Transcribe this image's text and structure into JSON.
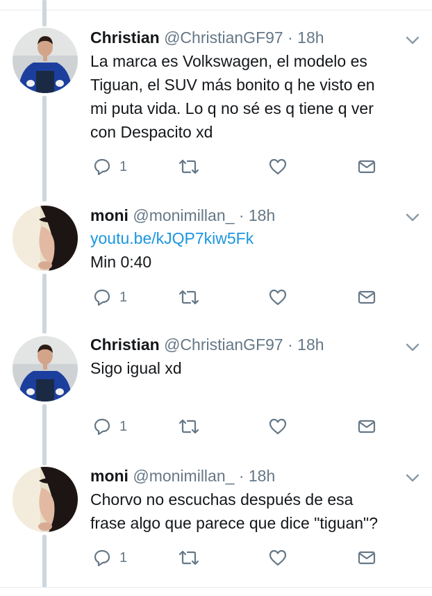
{
  "tweets": [
    {
      "name": "Christian",
      "handle": "@ChristianGF97",
      "separator": "·",
      "time": "18h",
      "lines": [
        {
          "text": "La marca es Volkswagen, el modelo es",
          "link": false
        },
        {
          "text": "Tiguan, el SUV más bonito q he visto en",
          "link": false
        },
        {
          "text": "mi puta vida. Lo q no sé es q tiene q ver",
          "link": false
        },
        {
          "text": "con Despacito xd",
          "link": false
        }
      ],
      "reply_count": "1",
      "avatar": "man-blue-shirt"
    },
    {
      "name": "moni",
      "handle": "@monimillan_",
      "separator": "·",
      "time": "18h",
      "lines": [
        {
          "text": "youtu.be/kJQP7kiw5Fk",
          "link": true
        },
        {
          "text": "Min 0:40",
          "link": false
        }
      ],
      "reply_count": "1",
      "avatar": "woman-profile"
    },
    {
      "name": "Christian",
      "handle": "@ChristianGF97",
      "separator": "·",
      "time": "18h",
      "lines": [
        {
          "text": "Sigo igual xd",
          "link": false
        }
      ],
      "reply_count": "1",
      "avatar": "man-blue-shirt"
    },
    {
      "name": "moni",
      "handle": "@monimillan_",
      "separator": "·",
      "time": "18h",
      "lines": [
        {
          "text": "Chorvo no escuchas después de esa",
          "link": false
        },
        {
          "text": "frase algo que parece que dice \"tiguan\"?",
          "link": false
        }
      ],
      "reply_count": "1",
      "avatar": "woman-profile"
    }
  ],
  "icons": {
    "reply": "reply-icon",
    "retweet": "retweet-icon",
    "like": "heart-icon",
    "message": "envelope-icon",
    "more": "chevron-down-icon"
  },
  "colors": {
    "text": "#14171a",
    "secondary": "#657786",
    "link": "#1b95e0",
    "icon": "#657786",
    "thread_line": "#ccd6dd"
  }
}
